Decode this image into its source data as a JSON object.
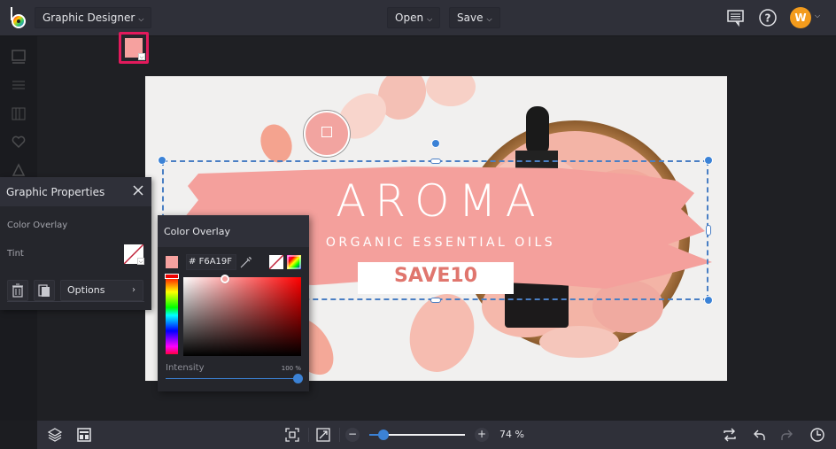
{
  "app": {
    "mode_label": "Graphic Designer",
    "open_label": "Open",
    "save_label": "Save",
    "avatar_initial": "W",
    "icons": [
      "comments-icon",
      "help-icon",
      "avatar-chevron-icon"
    ]
  },
  "left_rail": {
    "icons": [
      "image-icon",
      "adjust-icon",
      "library-icon",
      "favorites-icon",
      "shapes-icon"
    ]
  },
  "canvas": {
    "headline": "AROMA",
    "subtitle": "ORGANIC ESSENTIAL OILS",
    "coupon": "SAVE10"
  },
  "graphic_properties": {
    "title": "Graphic Properties",
    "color_overlay_label": "Color Overlay",
    "tint_label": "Tint",
    "options_label": "Options",
    "overlay_color": "#F6A19F",
    "highlight_color": "#E21A5C"
  },
  "color_overlay": {
    "title": "Color Overlay",
    "hex_prefix": "#",
    "hex_value": "F6A19F",
    "intensity_label": "Intensity",
    "intensity_value": "100 %",
    "intensity_fraction": 1.0
  },
  "bottom_bar": {
    "zoom_value": "74 %",
    "zoom_fraction": 0.15,
    "zoom_minus": "−",
    "zoom_plus": "+"
  },
  "colors": {
    "accent": "#3B82D6",
    "topbar": "#2F3039",
    "avatar": "#F39B1C",
    "brush": "#F4A09C",
    "coupon_text": "#E0766E"
  }
}
